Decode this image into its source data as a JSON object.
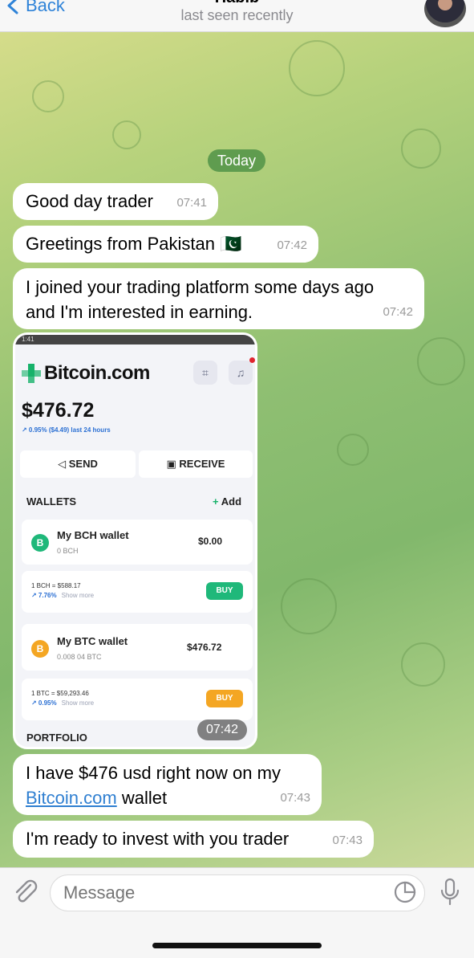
{
  "header": {
    "back_label": "Back",
    "contact_name": "Habib",
    "status": "last seen recently"
  },
  "chat": {
    "date_separator": "Today",
    "messages": [
      {
        "text": "Good day trader",
        "time": "07:41"
      },
      {
        "text": "Greetings from Pakistan 🇵🇰",
        "time": "07:42"
      },
      {
        "text": "I joined your trading platform some days ago and I'm interested in earning.",
        "time": "07:42"
      },
      {
        "text_prefix": "I have $476 usd right now on my",
        "link": "Bitcoin.com",
        "text_suffix": "wallet",
        "time": "07:43"
      },
      {
        "text": "I'm ready to invest with you trader",
        "time": "07:43"
      }
    ],
    "image_message": {
      "time": "07:42",
      "screenshot": {
        "status_bar": "1:41",
        "logo": "Bitcoin.com",
        "balance": "$476.72",
        "change": "↗ 0.95% ($4.49) last 24 hours",
        "send_label": "SEND",
        "receive_label": "RECEIVE",
        "wallets_heading": "WALLETS",
        "add_label": "Add",
        "wallets": [
          {
            "coin_symbol": "B",
            "coin_color": "#1fb87a",
            "name": "My BCH wallet",
            "sub": "0 BCH",
            "amount": "$0.00",
            "price": "1 BCH = $588.17",
            "change": "↗ 7.76%",
            "show_more": "Show more",
            "buy_label": "BUY",
            "buy_color": "#1fb87a"
          },
          {
            "coin_symbol": "B",
            "coin_color": "#f4a623",
            "name": "My BTC wallet",
            "sub": "0.008 04 BTC",
            "amount": "$476.72",
            "price": "1 BTC = $59,293.46",
            "change": "↗ 0.95%",
            "show_more": "Show more",
            "buy_label": "BUY",
            "buy_color": "#f4a623"
          }
        ],
        "portfolio_heading": "PORTFOLIO"
      }
    }
  },
  "input": {
    "placeholder": "Message"
  },
  "colors": {
    "accent": "#2f83d8",
    "date_pill": "#5f9c4f",
    "bitcoin_green": "#17b26a"
  }
}
